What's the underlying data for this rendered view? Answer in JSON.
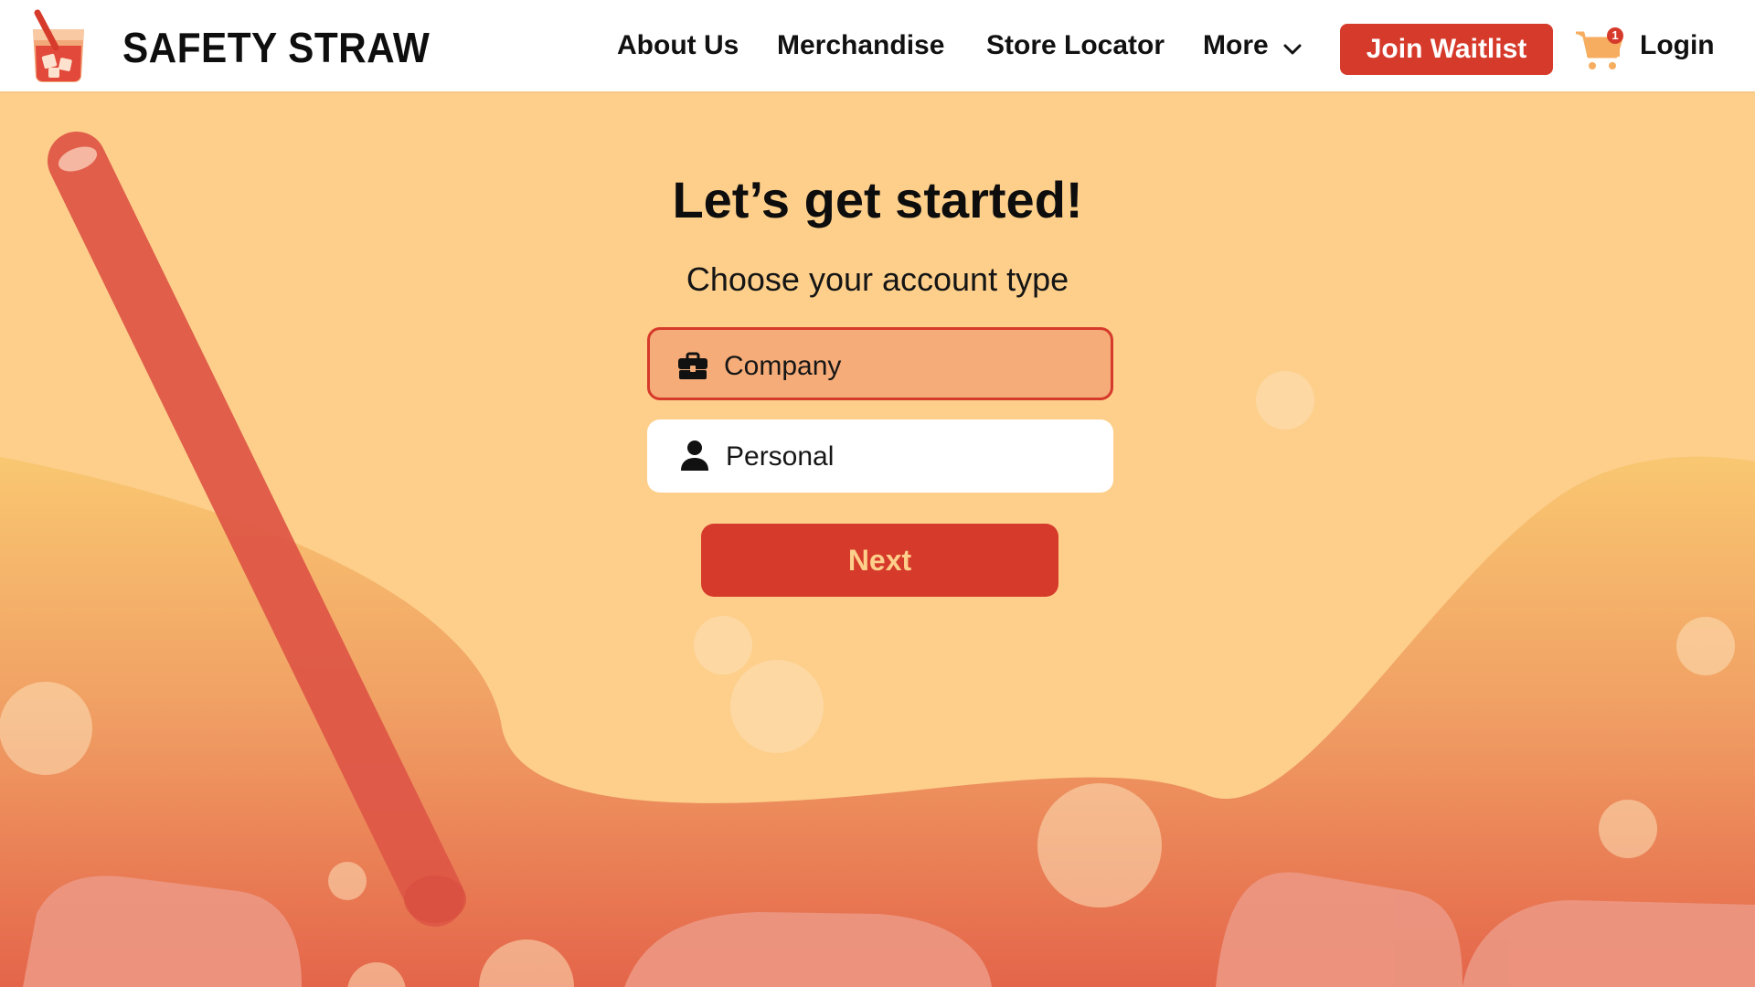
{
  "brand": {
    "name": "SAFETY STRAW",
    "logo_icon": "drink-cup-straw-icon"
  },
  "nav": {
    "about": "About Us",
    "merchandise": "Merchandise",
    "store_locator": "Store Locator",
    "more": "More",
    "join_waitlist": "Join Waitlist",
    "cart_count": "1",
    "login": "Login"
  },
  "main": {
    "title": "Let’s get started!",
    "subtitle": "Choose your account type",
    "options": [
      {
        "label": "Company",
        "icon": "briefcase-icon",
        "selected": true
      },
      {
        "label": "Personal",
        "icon": "person-icon",
        "selected": false
      }
    ],
    "next_label": "Next"
  },
  "colors": {
    "accent": "#d63a2b",
    "background": "#fdcf8b",
    "selected_option": "#f5ac78",
    "next_text": "#fdcf8b"
  }
}
